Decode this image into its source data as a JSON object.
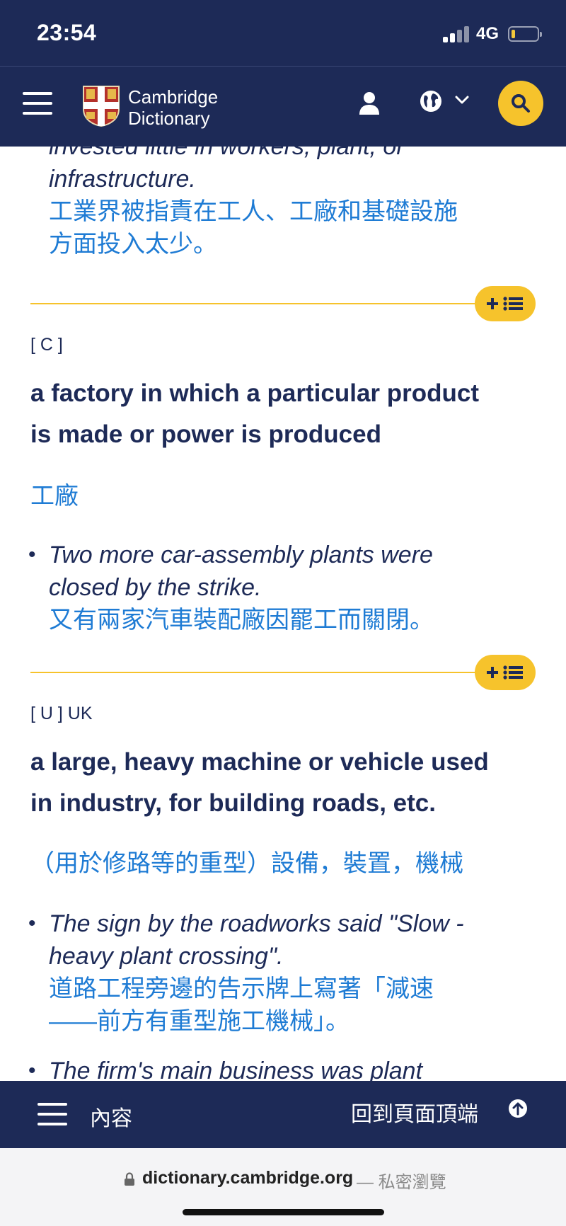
{
  "status": {
    "time": "23:54",
    "network": "4G"
  },
  "header": {
    "logo_line1": "Cambridge",
    "logo_line2": "Dictionary"
  },
  "content": {
    "top_example": {
      "line1": "invested little in workers, plant, or",
      "line2": "infrastructure.",
      "tr1": "工業界被指責在工人、工廠和基礎設施",
      "tr2": "方面投入太少。"
    },
    "sense1": {
      "grammar": "[ C ]",
      "def1": "a factory in which a particular product",
      "def2": "is made or power is produced",
      "translation": "工廠",
      "example": {
        "line1": "Two more car-assembly plants were",
        "line2": "closed by the strike.",
        "tr": "又有兩家汽車裝配廠因罷工而關閉。"
      }
    },
    "sense2": {
      "grammar": "[ U ] UK",
      "def1": "a large, heavy machine or vehicle used",
      "def2": "in industry, for building roads, etc.",
      "translation": "（用於修路等的重型）設備，裝置，機械",
      "example": {
        "line1": "The sign by the roadworks said \"Slow -",
        "line2": "heavy plant crossing\".",
        "tr1": "道路工程旁邊的告示牌上寫著「減速",
        "tr2": "——前方有重型施工機械」。"
      },
      "next_example": "The firm's main business was plant"
    },
    "bullet": "•"
  },
  "bottom_bar": {
    "contents_label": "內容",
    "back_to_top_label": "回到頁面頂端"
  },
  "url_bar": {
    "domain": "dictionary.cambridge.org",
    "suffix": "— 私密瀏覽"
  },
  "colors": {
    "navy": "#1d2a57",
    "link_blue": "#1e7bd4",
    "accent_yellow": "#f6c32c"
  }
}
